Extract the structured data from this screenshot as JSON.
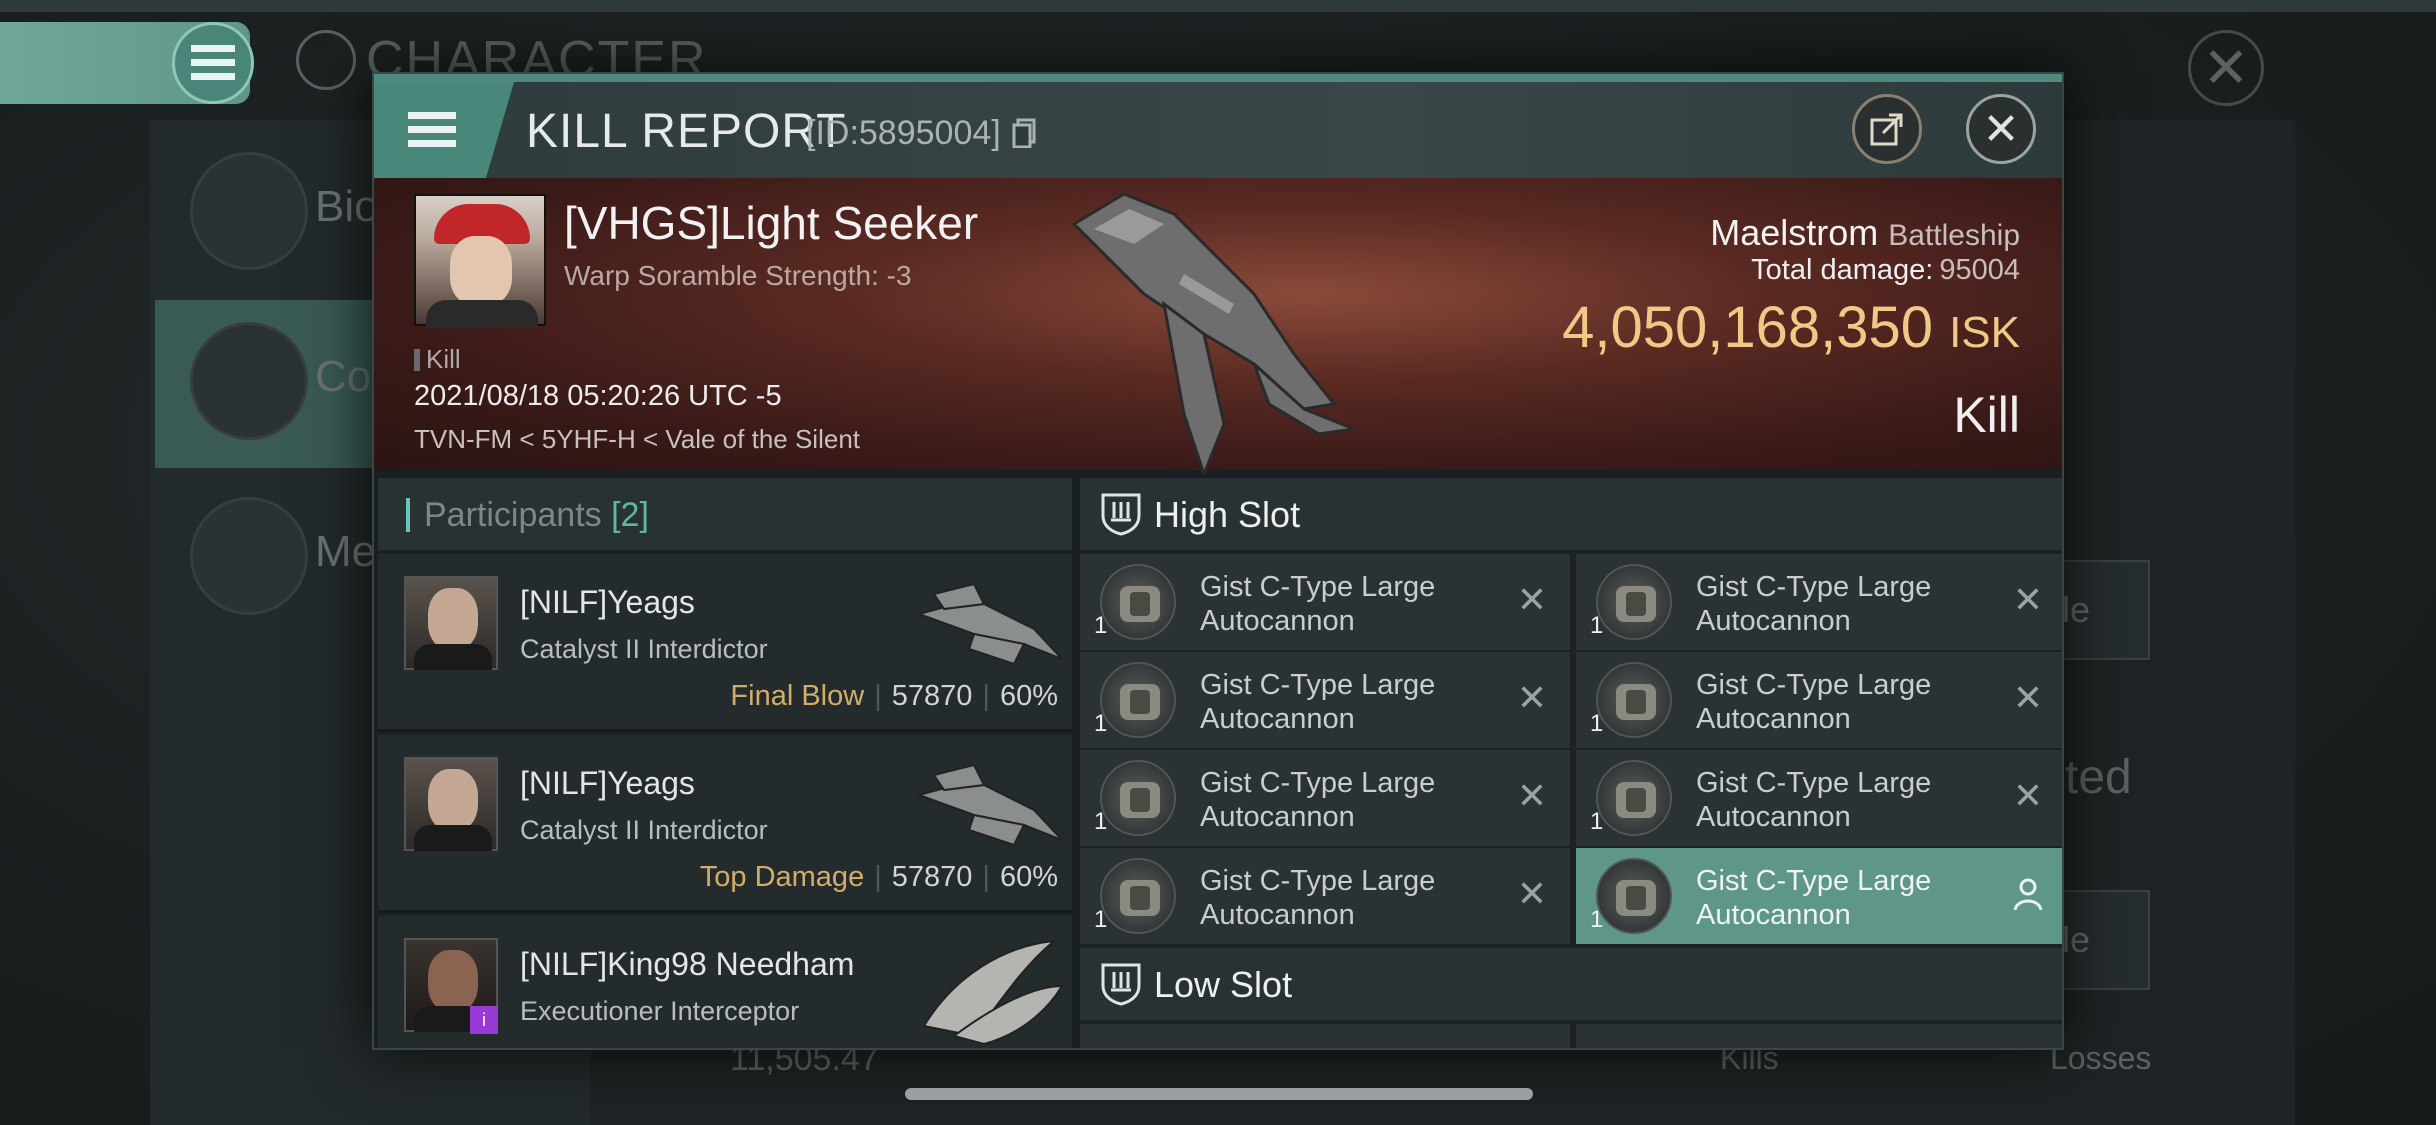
{
  "background": {
    "title": "CHARACTER",
    "side_items": [
      "Bio",
      "Co",
      "Me"
    ],
    "right_buttons": [
      "able",
      "able"
    ],
    "right_text": "ted",
    "bottom_value": "11,505.47",
    "bottom_kills": "Kills",
    "bottom_losses": "Losses"
  },
  "dialog": {
    "title": "KILL REPORT",
    "id_text": "[ID:5895004]",
    "icons": {
      "menu": "hamburger-menu-icon",
      "share": "share-icon",
      "close": "close-icon",
      "copy": "copy-icon"
    }
  },
  "victim": {
    "name": "[VHGS]Light Seeker",
    "warp": "Warp Soramble Strength: -3",
    "tag": "Kill",
    "datetime": "2021/08/18 05:20:26 UTC -5",
    "location": "TVN-FM < 5YHF-H < Vale of the Silent",
    "ship": "Maelstrom",
    "ship_class": "Battleship",
    "total_damage_label": "Total damage:",
    "total_damage": "95004",
    "isk_value": "4,050,168,350",
    "isk_unit": "ISK",
    "result": "Kill"
  },
  "participants": {
    "label": "Participants",
    "count": "[2]",
    "rows": [
      {
        "name": "[NILF]Yeags",
        "ship": "Catalyst II Interdictor",
        "tag": "Final Blow",
        "damage": "57870",
        "percent": "60%"
      },
      {
        "name": "[NILF]Yeags",
        "ship": "Catalyst II Interdictor",
        "tag": "Top Damage",
        "damage": "57870",
        "percent": "60%"
      },
      {
        "name": "[NILF]King98 Needham",
        "ship": "Executioner Interceptor",
        "tag": "",
        "damage": "",
        "percent": ""
      }
    ]
  },
  "slots": {
    "high_label": "High Slot",
    "low_label": "Low Slot",
    "high_modules": [
      {
        "line1": "Gist C-Type Large",
        "line2": "Autocannon",
        "qty": "1",
        "status": "destroyed"
      },
      {
        "line1": "Gist C-Type Large",
        "line2": "Autocannon",
        "qty": "1",
        "status": "destroyed"
      },
      {
        "line1": "Gist C-Type Large",
        "line2": "Autocannon",
        "qty": "1",
        "status": "destroyed"
      },
      {
        "line1": "Gist C-Type Large",
        "line2": "Autocannon",
        "qty": "1",
        "status": "destroyed"
      },
      {
        "line1": "Gist C-Type Large",
        "line2": "Autocannon",
        "qty": "1",
        "status": "destroyed"
      },
      {
        "line1": "Gist C-Type Large",
        "line2": "Autocannon",
        "qty": "1",
        "status": "destroyed"
      },
      {
        "line1": "Gist C-Type Large",
        "line2": "Autocannon",
        "qty": "1",
        "status": "destroyed"
      },
      {
        "line1": "Gist C-Type Large",
        "line2": "Autocannon",
        "qty": "1",
        "status": "dropped"
      }
    ]
  },
  "colors": {
    "accent": "#5e9688",
    "isk": "#f2c887",
    "tag": "#d2ad6a"
  }
}
